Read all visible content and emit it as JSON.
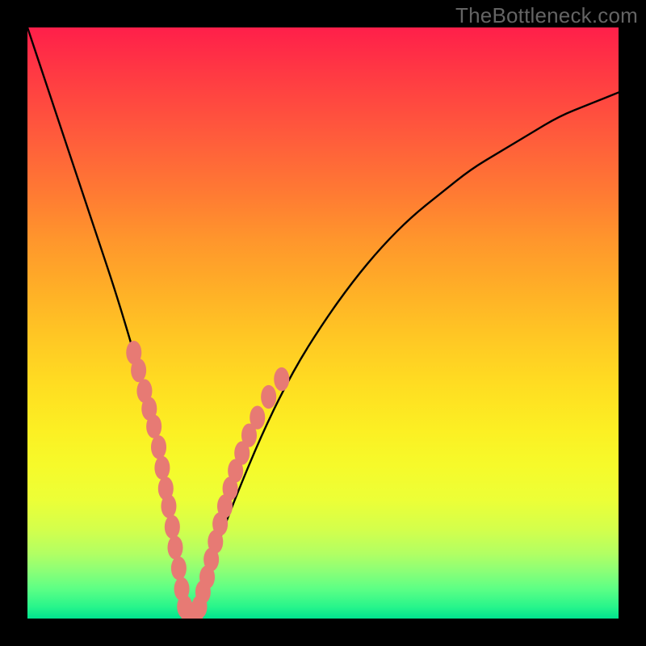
{
  "watermark": "TheBottleneck.com",
  "colors": {
    "frame": "#000000",
    "bead": "#e77a74",
    "curve": "#000000",
    "watermark": "#646464"
  },
  "chart_data": {
    "type": "line",
    "title": "",
    "xlabel": "",
    "ylabel": "",
    "xlim": [
      0,
      100
    ],
    "ylim": [
      0,
      100
    ],
    "grid": false,
    "legend": null,
    "annotations": [
      "TheBottleneck.com"
    ],
    "series": [
      {
        "name": "bottleneck-curve",
        "x": [
          0,
          3,
          6,
          9,
          12,
          15,
          18,
          20,
          22,
          23,
          24,
          25,
          26,
          27,
          28,
          29,
          30,
          32,
          35,
          40,
          45,
          50,
          55,
          60,
          65,
          70,
          75,
          80,
          85,
          90,
          95,
          100
        ],
        "y": [
          100,
          91,
          82,
          73,
          64,
          55,
          45,
          38,
          30,
          25,
          19,
          13,
          7,
          2,
          0,
          2,
          6,
          12,
          20,
          32,
          42,
          50,
          57,
          63,
          68,
          72,
          76,
          79,
          82,
          85,
          87,
          89
        ]
      }
    ],
    "beads_left": [
      {
        "x": 18.0,
        "y": 45.0
      },
      {
        "x": 18.8,
        "y": 42.0
      },
      {
        "x": 19.8,
        "y": 38.5
      },
      {
        "x": 20.6,
        "y": 35.5
      },
      {
        "x": 21.4,
        "y": 32.5
      },
      {
        "x": 22.2,
        "y": 29.0
      },
      {
        "x": 22.8,
        "y": 25.5
      },
      {
        "x": 23.4,
        "y": 22.0
      },
      {
        "x": 23.9,
        "y": 19.0
      },
      {
        "x": 24.5,
        "y": 15.5
      },
      {
        "x": 25.0,
        "y": 12.0
      },
      {
        "x": 25.6,
        "y": 8.5
      },
      {
        "x": 26.1,
        "y": 5.0
      }
    ],
    "beads_bottom": [
      {
        "x": 26.6,
        "y": 2.0
      },
      {
        "x": 27.2,
        "y": 1.0
      },
      {
        "x": 27.8,
        "y": 0.5
      },
      {
        "x": 28.5,
        "y": 1.0
      },
      {
        "x": 29.1,
        "y": 2.0
      }
    ],
    "beads_right": [
      {
        "x": 29.7,
        "y": 4.5
      },
      {
        "x": 30.4,
        "y": 7.0
      },
      {
        "x": 31.1,
        "y": 10.0
      },
      {
        "x": 31.8,
        "y": 13.0
      },
      {
        "x": 32.6,
        "y": 16.0
      },
      {
        "x": 33.4,
        "y": 19.0
      },
      {
        "x": 34.3,
        "y": 22.0
      },
      {
        "x": 35.2,
        "y": 25.0
      },
      {
        "x": 36.3,
        "y": 28.0
      },
      {
        "x": 37.5,
        "y": 31.0
      },
      {
        "x": 38.9,
        "y": 34.0
      },
      {
        "x": 40.8,
        "y": 37.5
      },
      {
        "x": 43.0,
        "y": 40.5
      }
    ],
    "bead_rx": 1.3,
    "bead_ry": 2.0
  }
}
